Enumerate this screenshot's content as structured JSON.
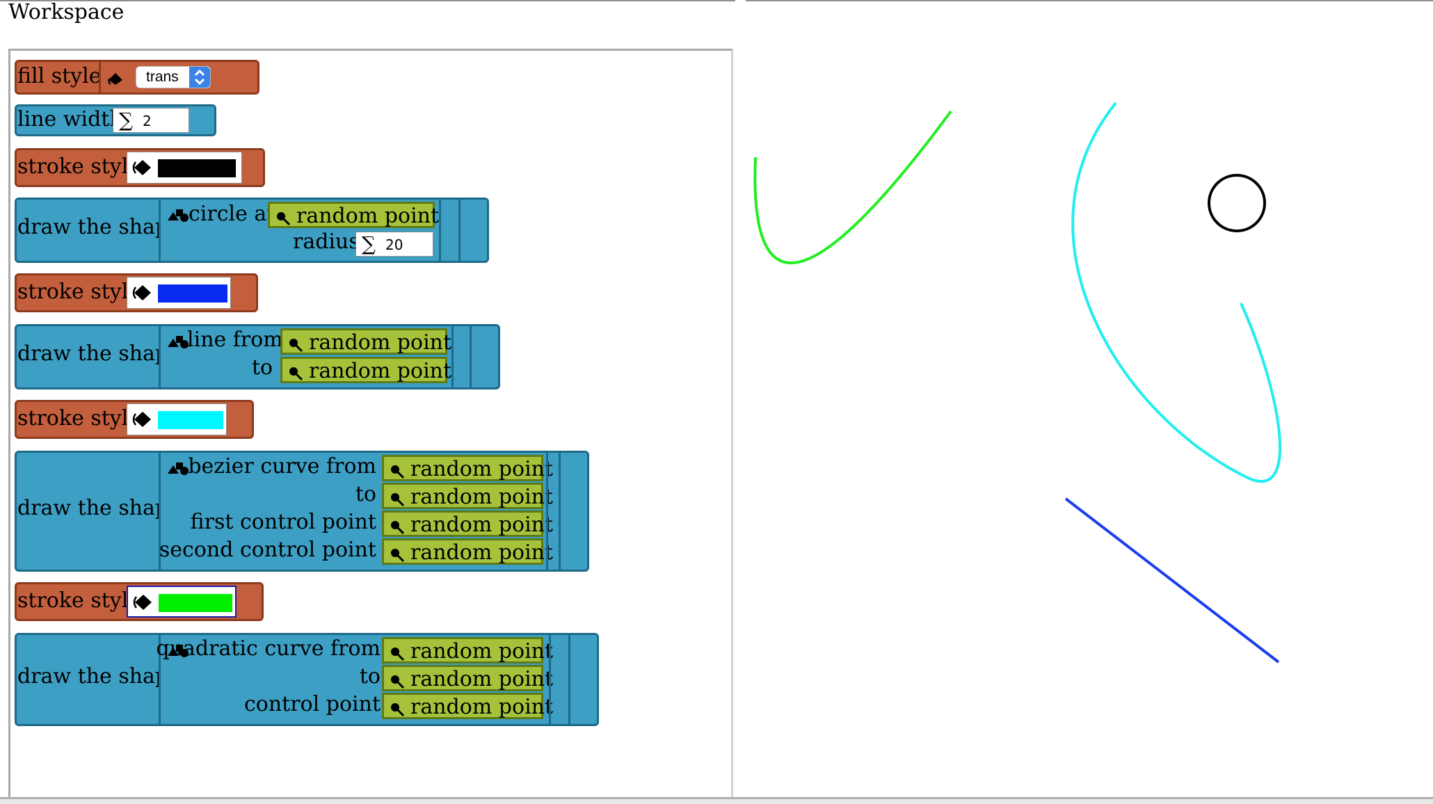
{
  "workspace": {
    "title": "Workspace"
  },
  "blocks": {
    "fill_style": {
      "label": "fill style",
      "value": "trans"
    },
    "line_width": {
      "label": "line width",
      "sigma": "∑",
      "value": "2"
    },
    "stroke1": {
      "label": "stroke style",
      "color": "#000000"
    },
    "circle": {
      "label": "draw the shape",
      "shape_label": "circle at",
      "point": "random point",
      "radius_label": "radius",
      "sigma": "∑",
      "radius_value": "20"
    },
    "stroke2": {
      "label": "stroke style",
      "color": "#0a2cf0"
    },
    "line": {
      "label": "draw the shape",
      "shape_label": "line from",
      "to_label": "to",
      "point_from": "random point",
      "point_to": "random point"
    },
    "stroke3": {
      "label": "stroke style",
      "color": "#00f7ff"
    },
    "bezier": {
      "label": "draw the shape",
      "shape_label": "bezier curve from",
      "to_label": "to",
      "cp1_label": "first control point",
      "cp2_label": "second control point",
      "p1": "random point",
      "p2": "random point",
      "p3": "random point",
      "p4": "random point"
    },
    "stroke4": {
      "label": "stroke style",
      "color": "#00ef00"
    },
    "quad": {
      "label": "draw the shape",
      "shape_label": "quadratic curve from",
      "to_label": "to",
      "cp_label": "control point",
      "p1": "random point",
      "p2": "random point",
      "p3": "random point"
    }
  },
  "canvas": {
    "colors": {
      "green": "#22ee22",
      "cyan": "#22eeee",
      "blue": "#1a3df0",
      "black": "#000000"
    }
  }
}
